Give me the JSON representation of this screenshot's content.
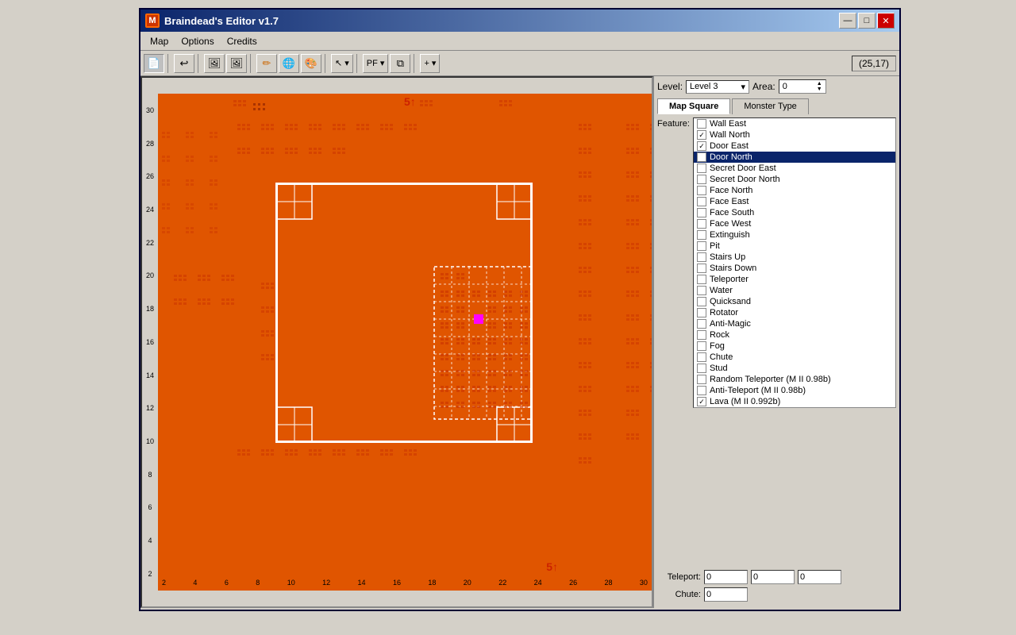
{
  "window": {
    "title": "Braindead's Editor v1.7",
    "icon": "M",
    "coords": "(25,17)",
    "minimize": "—",
    "maximize": "□",
    "close": "✕"
  },
  "menu": {
    "items": [
      "Map",
      "Options",
      "Credits"
    ]
  },
  "toolbar": {
    "buttons": [
      "new",
      "undo",
      "img1",
      "img2",
      "pencil",
      "globe",
      "paint"
    ],
    "dropdowns": [
      "cursor",
      "PF",
      "copy",
      "add"
    ]
  },
  "level_area": {
    "level_label": "Level:",
    "level_value": "Level 3",
    "area_label": "Area:",
    "area_value": "0"
  },
  "tabs": {
    "items": [
      "Map Square",
      "Monster Type"
    ],
    "active": "Map Square"
  },
  "feature_label": "Feature:",
  "features": [
    {
      "label": "Wall East",
      "checked": false,
      "selected": false
    },
    {
      "label": "Wall North",
      "checked": true,
      "selected": false
    },
    {
      "label": "Door East",
      "checked": true,
      "selected": false
    },
    {
      "label": "Door North",
      "checked": false,
      "selected": true
    },
    {
      "label": "Secret Door East",
      "checked": false,
      "selected": false
    },
    {
      "label": "Secret Door North",
      "checked": false,
      "selected": false
    },
    {
      "label": "Face North",
      "checked": false,
      "selected": false
    },
    {
      "label": "Face East",
      "checked": false,
      "selected": false
    },
    {
      "label": "Face South",
      "checked": false,
      "selected": false
    },
    {
      "label": "Face West",
      "checked": false,
      "selected": false
    },
    {
      "label": "Extinguish",
      "checked": false,
      "selected": false
    },
    {
      "label": "Pit",
      "checked": false,
      "selected": false
    },
    {
      "label": "Stairs Up",
      "checked": false,
      "selected": false
    },
    {
      "label": "Stairs Down",
      "checked": false,
      "selected": false
    },
    {
      "label": "Teleporter",
      "checked": false,
      "selected": false
    },
    {
      "label": "Water",
      "checked": false,
      "selected": false
    },
    {
      "label": "Quicksand",
      "checked": false,
      "selected": false
    },
    {
      "label": "Rotator",
      "checked": false,
      "selected": false
    },
    {
      "label": "Anti-Magic",
      "checked": false,
      "selected": false
    },
    {
      "label": "Rock",
      "checked": false,
      "selected": false
    },
    {
      "label": "Fog",
      "checked": false,
      "selected": false
    },
    {
      "label": "Chute",
      "checked": false,
      "selected": false
    },
    {
      "label": "Stud",
      "checked": false,
      "selected": false
    },
    {
      "label": "Random Teleporter (M II 0.98b)",
      "checked": false,
      "selected": false
    },
    {
      "label": "Anti-Teleport  (M II 0.98b)",
      "checked": false,
      "selected": false
    },
    {
      "label": "Lava (M II 0.992b)",
      "checked": true,
      "selected": false
    }
  ],
  "bottom_fields": {
    "teleport_label": "Teleport:",
    "teleport_val1": "0",
    "teleport_val2": "0",
    "teleport_val3": "0",
    "chute_label": "Chute:",
    "chute_val": "0"
  },
  "map": {
    "y_labels": [
      "30",
      "28",
      "26",
      "24",
      "22",
      "20",
      "18",
      "16",
      "14",
      "12",
      "10",
      "8",
      "6",
      "4",
      "2"
    ],
    "x_labels": [
      "2",
      "4",
      "6",
      "8",
      "10",
      "12",
      "14",
      "16",
      "18",
      "20",
      "22",
      "24",
      "26",
      "28",
      "30"
    ],
    "sticker1": "5↑",
    "sticker2": "5↑"
  }
}
